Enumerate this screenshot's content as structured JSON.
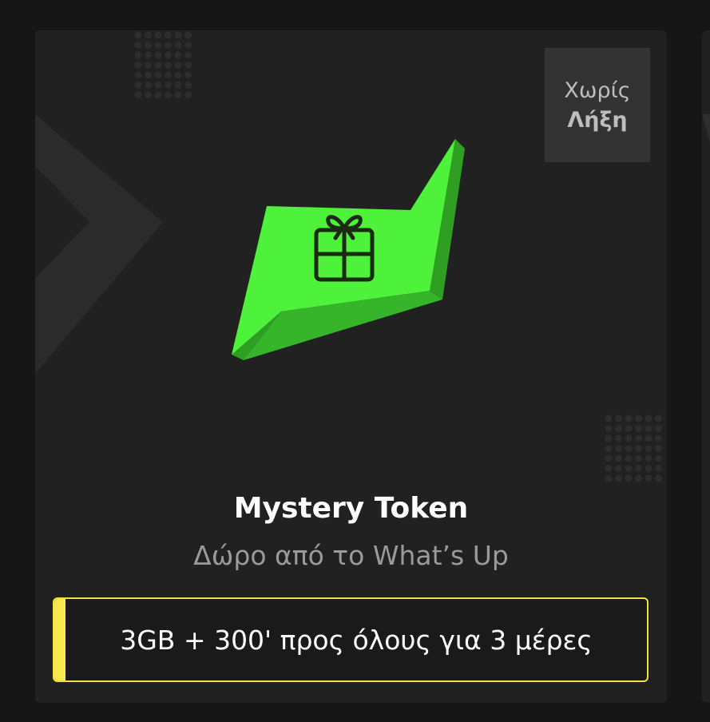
{
  "card": {
    "expiry_badge": {
      "line1": "Χωρίς",
      "line2": "Λήξη"
    },
    "icon": "gift-icon",
    "title": "Mystery Token",
    "subtitle": "Δώρο από το What’s Up",
    "offer": "3GB + 300' προς όλους για 3 μέρες"
  },
  "colors": {
    "background": "#161616",
    "card": "#212121",
    "badge": "#333333",
    "token_green": "#4ff23a",
    "accent_yellow": "#f6e84e"
  }
}
